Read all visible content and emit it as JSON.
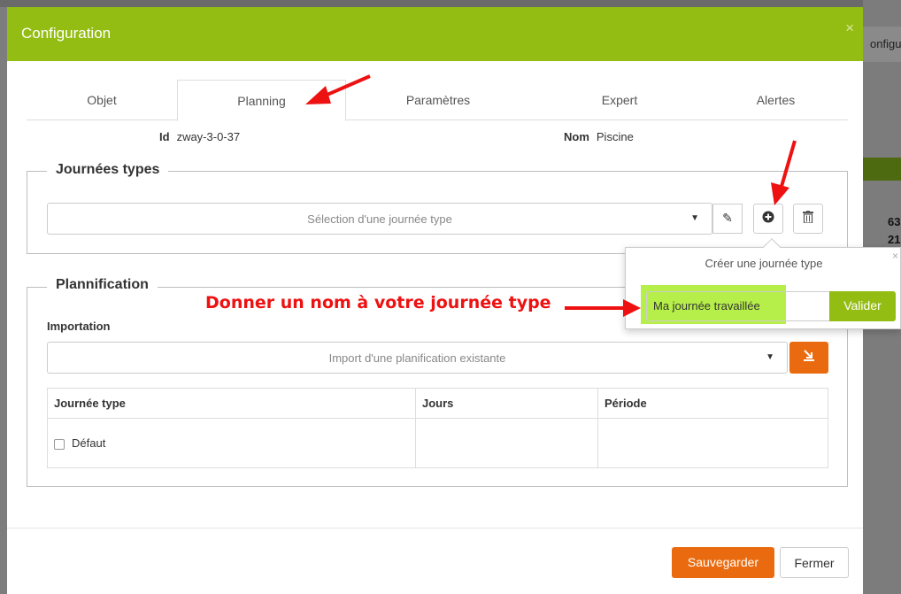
{
  "background": {
    "right_tab_text": "onfigu",
    "numbers": [
      "63",
      "21"
    ]
  },
  "modal": {
    "title": "Configuration",
    "close": "×",
    "tabs": [
      {
        "label": "Objet"
      },
      {
        "label": "Planning",
        "active": true
      },
      {
        "label": "Paramètres"
      },
      {
        "label": "Expert"
      },
      {
        "label": "Alertes"
      }
    ],
    "id_label": "Id",
    "id_value": "zway-3-0-37",
    "nom_label": "Nom",
    "nom_value": "Piscine"
  },
  "journees": {
    "legend": "Journées types",
    "select_placeholder": "Sélection d'une journée type",
    "icons": [
      "pencil-icon",
      "plus-circle-icon",
      "trash-icon"
    ]
  },
  "planification": {
    "legend": "Plannification",
    "import_label": "Importation",
    "import_placeholder": "Import d'une planification existante",
    "table": {
      "headers": [
        "Journée type",
        "Jours",
        "Période"
      ],
      "rows": [
        {
          "journee": "Défaut",
          "jours": "",
          "periode": ""
        }
      ]
    }
  },
  "footer": {
    "save_label": "Sauvegarder",
    "close_label": "Fermer"
  },
  "popover": {
    "title": "Créer une journée type",
    "close": "×",
    "input_value": "Ma journée travaillée",
    "submit_label": "Valider"
  },
  "annotation": {
    "text": "Donner un nom à votre journée type",
    "color": "#ee1111"
  },
  "colors": {
    "header_green": "#94bd13",
    "orange": "#ea6b0f",
    "highlight": "#a9ec2a"
  }
}
